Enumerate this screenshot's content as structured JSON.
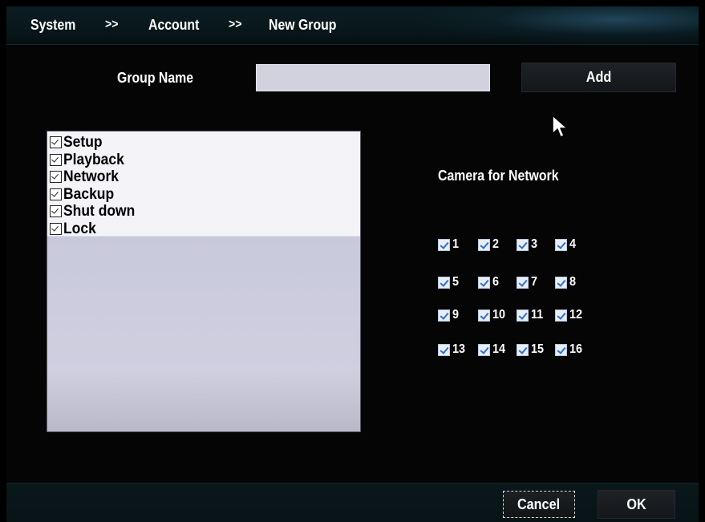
{
  "breadcrumb": {
    "items": [
      "System",
      "Account",
      "New Group"
    ],
    "separator": ">>"
  },
  "form": {
    "group_name_label": "Group Name",
    "group_name_value": "",
    "add_label": "Add"
  },
  "permissions": {
    "items": [
      {
        "label": "Setup",
        "checked": true
      },
      {
        "label": "Playback",
        "checked": true
      },
      {
        "label": "Network",
        "checked": true
      },
      {
        "label": "Backup",
        "checked": true
      },
      {
        "label": "Shut down",
        "checked": true
      },
      {
        "label": "Lock",
        "checked": true
      }
    ]
  },
  "cameras": {
    "title": "Camera for Network",
    "items": [
      "1",
      "2",
      "3",
      "4",
      "5",
      "6",
      "7",
      "8",
      "9",
      "10",
      "11",
      "12",
      "13",
      "14",
      "15",
      "16"
    ]
  },
  "footer": {
    "cancel_label": "Cancel",
    "ok_label": "OK"
  },
  "colors": {
    "background": "#000000",
    "header": "#0b1d22",
    "input_bg": "#d2d2de",
    "panel_bg": "#f4f4f8",
    "checkmark": "#2b6fd6"
  },
  "icons": {
    "cursor": "mouse-pointer-icon"
  }
}
